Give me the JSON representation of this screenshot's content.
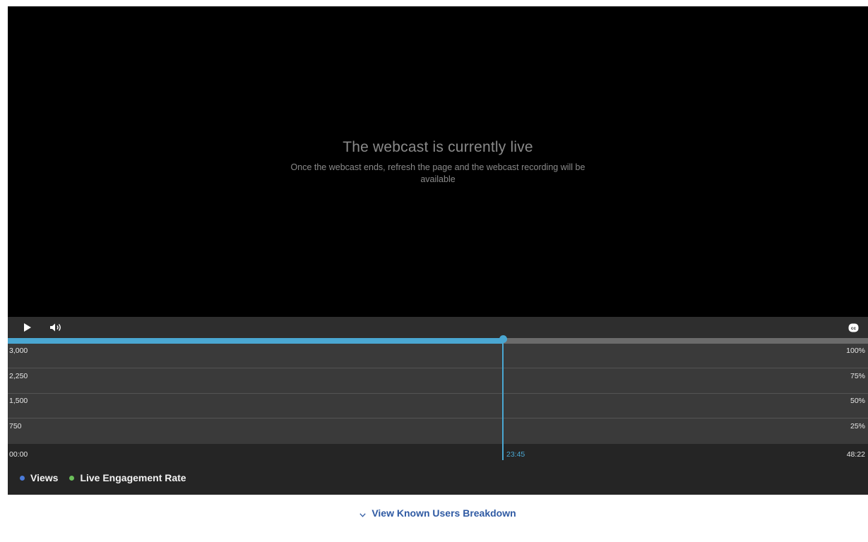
{
  "video": {
    "status_title": "The webcast is currently live",
    "status_subtitle": "Once the webcast ends, refresh the page and the webcast recording will be available"
  },
  "controls": {
    "play_icon": "play-icon",
    "volume_icon": "volume-icon",
    "cc_icon": "closed-captions-icon",
    "progress_fraction": 0.5758
  },
  "chart": {
    "left_ticks": [
      "3,000",
      "2,250",
      "1,500",
      "750"
    ],
    "right_ticks": [
      "100%",
      "75%",
      "50%",
      "25%"
    ]
  },
  "timeline": {
    "start": "00:00",
    "current": "23:45",
    "end": "48:22"
  },
  "legend": {
    "items": [
      {
        "label": "Views",
        "color": "#4b7bd8"
      },
      {
        "label": "Live Engagement Rate",
        "color": "#6bbf5a"
      }
    ]
  },
  "breakdown": {
    "link_label": "View Known Users Breakdown"
  },
  "colors": {
    "accent": "#4aa7d2",
    "link": "#2f5aa3"
  }
}
